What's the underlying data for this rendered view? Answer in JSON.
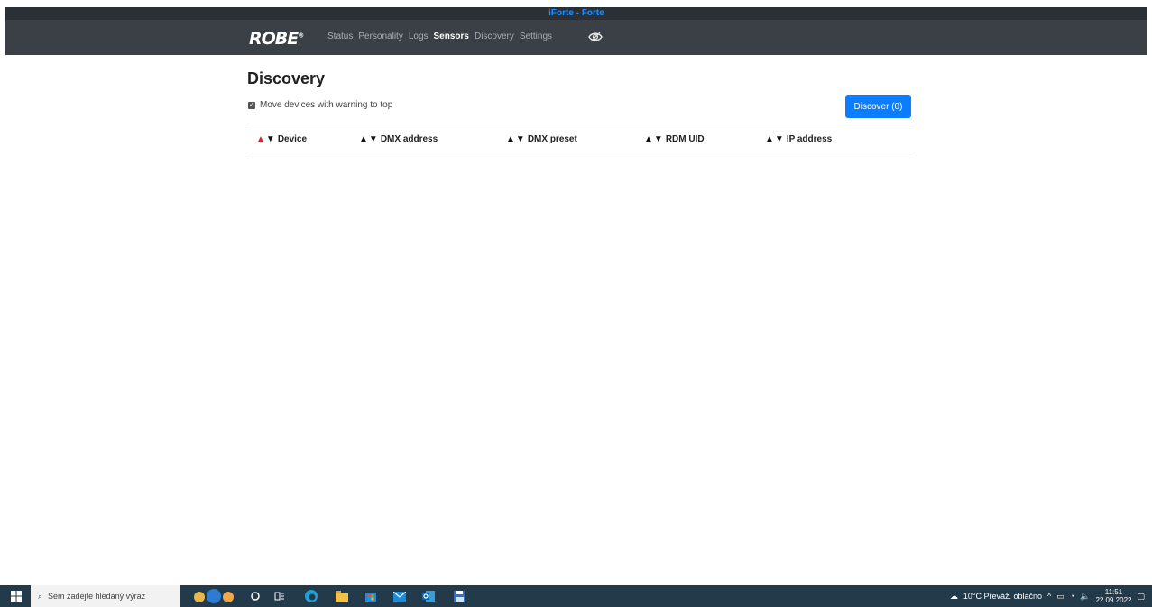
{
  "window": {
    "title": "iForte - Forte"
  },
  "brand": {
    "logo_text": "ROBE",
    "logo_mark": "®"
  },
  "nav": {
    "items": [
      {
        "label": "Status"
      },
      {
        "label": "Personality"
      },
      {
        "label": "Logs"
      },
      {
        "label": "Sensors"
      },
      {
        "label": "Discovery"
      },
      {
        "label": "Settings"
      }
    ],
    "active": "Sensors",
    "eye_icon": "eye-icon"
  },
  "page": {
    "title": "Discovery"
  },
  "options": {
    "move_warning_label": "Move devices with warning to top",
    "move_warning_checked": true
  },
  "actions": {
    "discover_label": "Discover (0)"
  },
  "table": {
    "columns": [
      {
        "label": "Device",
        "sort_active_up": true
      },
      {
        "label": "DMX address",
        "sort_active_up": false
      },
      {
        "label": "DMX preset",
        "sort_active_up": false
      },
      {
        "label": "RDM UID",
        "sort_active_up": false
      },
      {
        "label": "IP address",
        "sort_active_up": false
      }
    ],
    "rows": []
  },
  "taskbar": {
    "search_placeholder": "Sem zadejte hledaný výraz",
    "weather": "10°C  Převáž. oblačno",
    "time": "11:51",
    "date": "22.09.2022"
  },
  "colors": {
    "accent": "#0d7dff",
    "navbar": "#3b4046",
    "titlebar": "#2b3036",
    "sort_active": "#e0242b",
    "taskbar": "#233a4a"
  }
}
